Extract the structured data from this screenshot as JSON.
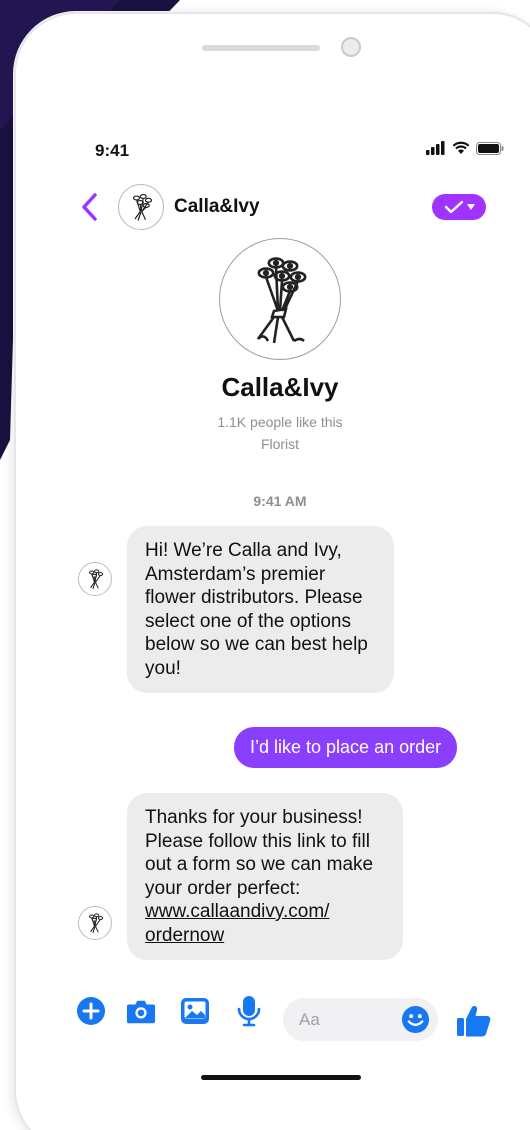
{
  "status_bar": {
    "time": "9:41"
  },
  "header": {
    "name": "Calla&Ivy"
  },
  "profile": {
    "name": "Calla&Ivy",
    "likes": "1.1K people like this",
    "category": "Florist"
  },
  "conversation": {
    "timestamp": "9:41 AM",
    "messages": [
      {
        "from": "page",
        "text": "Hi! We’re Calla and Ivy, Amsterdam’s premier flower distributors. Please select one of the options below so we can best help you!"
      },
      {
        "from": "user",
        "text": "I’d like to place an order"
      },
      {
        "from": "page",
        "text": "Thanks for your business! Please follow this link to fill out a form so we can make your order perfect:",
        "link": "www.callaandivy.com/ ordernow"
      }
    ]
  },
  "composer": {
    "placeholder": "Aa"
  },
  "colors": {
    "accent": "#8a3ffc",
    "verify": "#a033ff",
    "tool_blue": "#1877f2",
    "background_dark": "#1a1140",
    "incoming_bubble": "#ececec"
  }
}
